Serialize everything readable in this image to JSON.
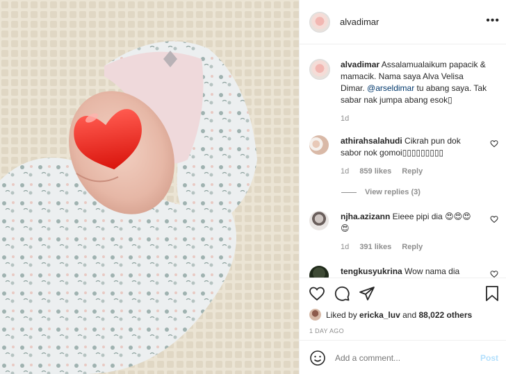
{
  "header": {
    "username": "alvadimar",
    "more_icon": "more-dots-icon"
  },
  "caption": {
    "username": "alvadimar",
    "text_before_mention": " Assalamualaikum papacik & mamacik. Nama saya Alva Velisa Dimar. ",
    "mention": "@arseldimar",
    "text_after_mention": " tu abang saya. Tak sabar nak jumpa abang esok▯",
    "time": "1d"
  },
  "comments": [
    {
      "username": "athirahsalahudi",
      "text": " Cikrah pun dok sabor nok gomoi▯▯▯▯▯▯▯▯▯",
      "time": "1d",
      "likes": "859 likes",
      "reply": "Reply"
    },
    {
      "username": "njha.azizann",
      "text": " Eieee pipi dia 😍😍😍😍",
      "time": "1d",
      "likes": "391 likes",
      "reply": "Reply"
    },
    {
      "username": "tengkusyukrina",
      "text": " Wow nama dia"
    }
  ],
  "view_replies": "View replies (3)",
  "likes": {
    "prefix": "Liked by ",
    "user": "ericka_luv",
    "middle": " and ",
    "count": "88,022 others"
  },
  "date": "1 DAY AGO",
  "add_comment": {
    "placeholder": "Add a comment...",
    "post_label": "Post"
  },
  "colors": {
    "link": "#00376b",
    "muted": "#8e8e8e",
    "post_disabled": "#b2dffc",
    "heart_overlay": "#e8231b"
  }
}
